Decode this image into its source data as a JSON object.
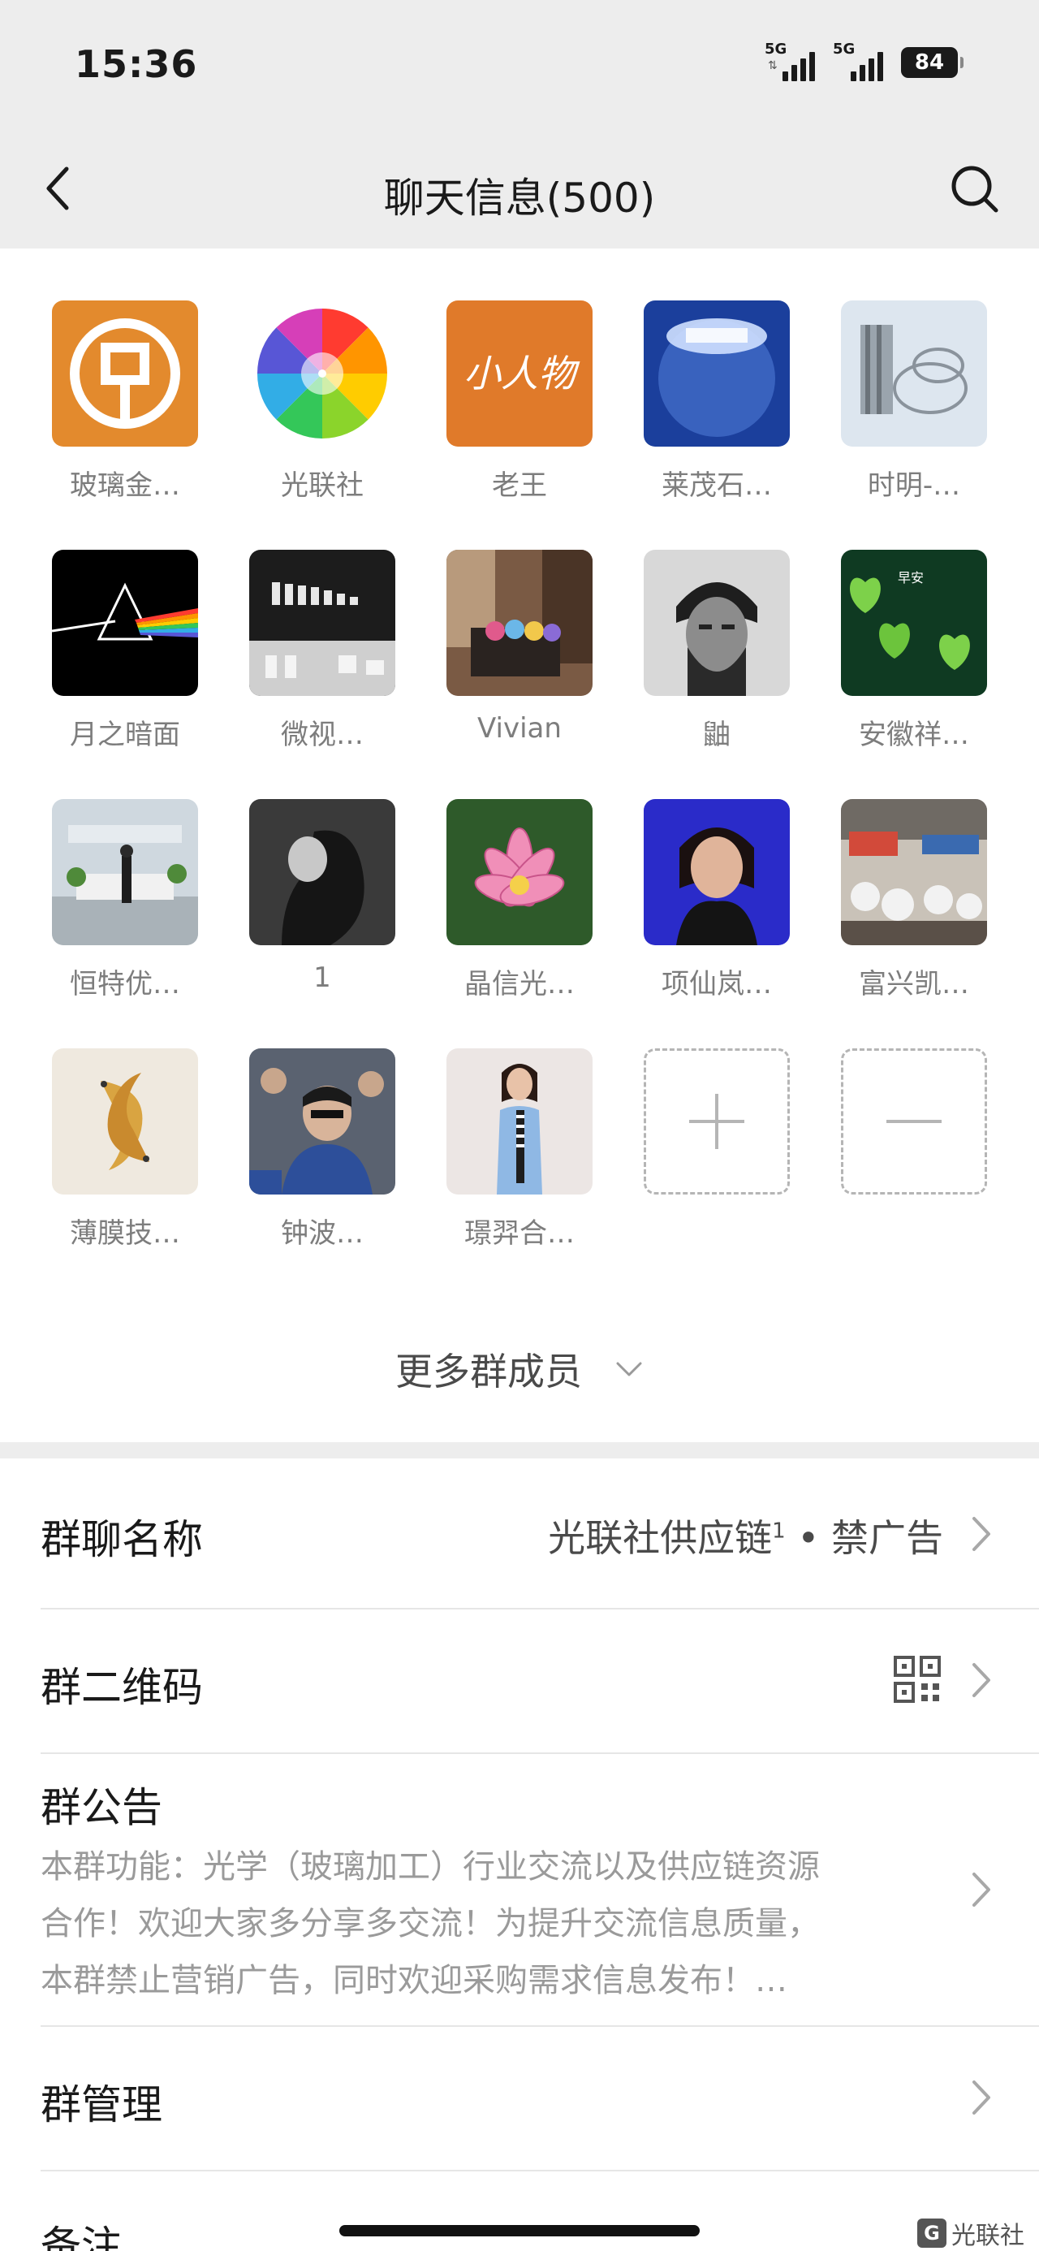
{
  "status_bar": {
    "time": "15:36",
    "signal_1": "5G",
    "signal_2": "5G",
    "battery": "84"
  },
  "header": {
    "title": "聊天信息(500)"
  },
  "members": [
    {
      "name": "玻璃金…",
      "avatar": "bank-logo-avatar"
    },
    {
      "name": "光联社",
      "avatar": "color-wheel-avatar"
    },
    {
      "name": "老王",
      "avatar": "calligraphy-avatar",
      "avatar_text": "小人物"
    },
    {
      "name": "莱茂石…",
      "avatar": "glass-lens-avatar"
    },
    {
      "name": "时明-…",
      "avatar": "sketch-avatar"
    },
    {
      "name": "月之暗面",
      "avatar": "prism-avatar"
    },
    {
      "name": "微视…",
      "avatar": "product-photo-avatar"
    },
    {
      "name": "Vivian",
      "avatar": "room-photo-avatar"
    },
    {
      "name": "鼬",
      "avatar": "portrait-avatar"
    },
    {
      "name": "安徽祥…",
      "avatar": "green-hearts-avatar",
      "avatar_text": "早安"
    },
    {
      "name": "恒特优…",
      "avatar": "office-lobby-avatar"
    },
    {
      "name": "1",
      "avatar": "grey-portrait-avatar"
    },
    {
      "name": "晶信光…",
      "avatar": "lotus-avatar"
    },
    {
      "name": "项仙岚…",
      "avatar": "woman-portrait-avatar"
    },
    {
      "name": "富兴凯…",
      "avatar": "exhibition-avatar"
    },
    {
      "name": "薄膜技…",
      "avatar": "koi-fish-avatar"
    },
    {
      "name": "钟波…",
      "avatar": "conference-avatar"
    },
    {
      "name": "璟羿合…",
      "avatar": "fashion-avatar"
    }
  ],
  "more_members_label": "更多群成员",
  "settings": {
    "group_name_label": "群聊名称",
    "group_name_value": "光联社供应链",
    "group_name_sup": "1",
    "group_name_suffix": " • 禁广告",
    "qr_label": "群二维码",
    "notice_label": "群公告",
    "notice_line1": "本群功能：光学（玻璃加工）行业交流以及供应链资源",
    "notice_line2": "合作！欢迎大家多分享多交流！为提升交流信息质量，",
    "notice_line3": "本群禁止营销广告，同时欢迎采购需求信息发布！…",
    "manage_label": "群管理",
    "remark_label": "备注"
  },
  "watermark": {
    "logo": "G",
    "text": "光联社"
  },
  "colors": {
    "page_bg": "#ededed",
    "text_primary": "#1a1a1a",
    "text_secondary": "#7d7d7d",
    "notice_text": "#9a9a9a"
  }
}
